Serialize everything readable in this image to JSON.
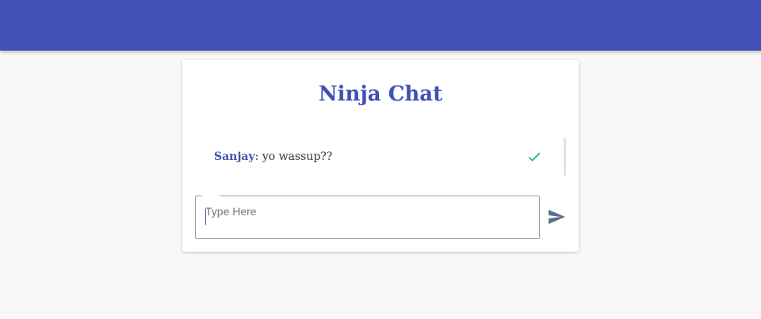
{
  "app": {
    "title": "Ninja Chat"
  },
  "messages": [
    {
      "sender": "Sanjay",
      "separator": ": ",
      "text": "yo wassup??",
      "status_icon": "check-icon"
    }
  ],
  "composer": {
    "placeholder": "Type Here",
    "value": "",
    "send_icon": "send-icon"
  },
  "colors": {
    "primary": "#3f51b5",
    "check": "#26a69a",
    "send": "#5c6f8a",
    "background": "#f8f8f8"
  }
}
